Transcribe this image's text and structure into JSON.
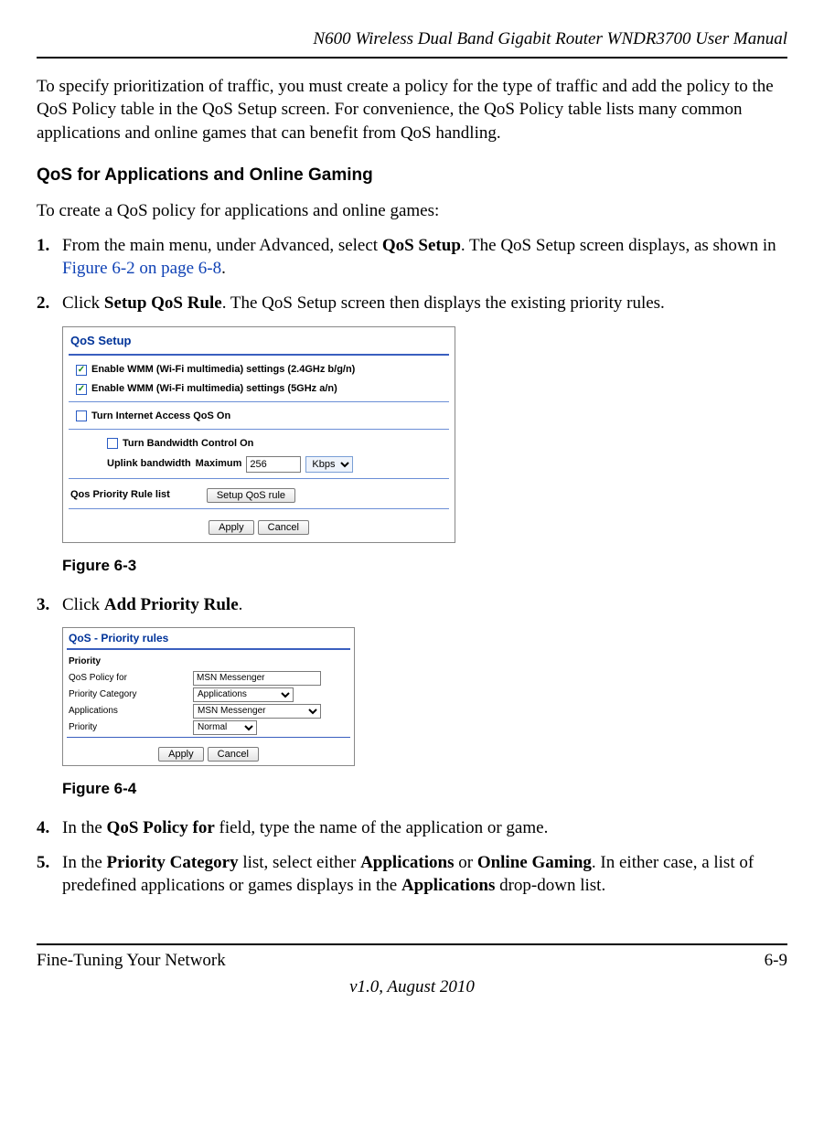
{
  "header": {
    "title": "N600 Wireless Dual Band Gigabit Router WNDR3700 User Manual"
  },
  "intro": "To specify prioritization of traffic, you must create a policy for the type of traffic and add the policy to the QoS Policy table in the QoS Setup screen. For convenience, the QoS Policy table lists many common applications and online games that can benefit from QoS handling.",
  "section_heading": "QoS for Applications and Online Gaming",
  "section_intro": "To create a QoS policy for applications and online games:",
  "steps": {
    "s1": {
      "num": "1.",
      "pre": "From the main menu, under Advanced, select ",
      "bold1": "QoS Setup",
      "mid": ". The QoS Setup screen displays, as shown in ",
      "link": "Figure 6-2 on page 6-8",
      "post": "."
    },
    "s2": {
      "num": "2.",
      "pre": "Click ",
      "bold1": "Setup QoS Rule",
      "post": ". The QoS Setup screen then displays the existing priority rules."
    },
    "s3": {
      "num": "3.",
      "pre": "Click ",
      "bold1": "Add Priority Rule",
      "post": "."
    },
    "s4": {
      "num": "4.",
      "pre": "In the ",
      "bold1": "QoS Policy for",
      "post": " field, type the name of the application or game."
    },
    "s5": {
      "num": "5.",
      "pre": "In the ",
      "bold1": "Priority Category",
      "mid1": " list, select either ",
      "bold2": "Applications",
      "mid2": " or ",
      "bold3": "Online Gaming",
      "mid3": ". In either case, a list of predefined applications or games displays in the ",
      "bold4": "Applications",
      "post": " drop-down list."
    }
  },
  "fig63": {
    "caption": "Figure 6-3",
    "panel_title": "QoS Setup",
    "wmm24": "Enable WMM (Wi-Fi multimedia) settings (2.4GHz b/g/n)",
    "wmm5": "Enable WMM (Wi-Fi multimedia) settings (5GHz a/n)",
    "internet_qos": "Turn Internet Access QoS On",
    "bandwidth_ctrl": "Turn Bandwidth Control On",
    "uplink_label": "Uplink bandwidth",
    "uplink_max": "Maximum",
    "uplink_value": "256",
    "uplink_unit": "Kbps",
    "rule_list_label": "Qos Priority Rule list",
    "setup_rule_btn": "Setup QoS rule",
    "apply_btn": "Apply",
    "cancel_btn": "Cancel"
  },
  "fig64": {
    "caption": "Figure 6-4",
    "panel_title": "QoS - Priority rules",
    "section": "Priority",
    "lbl_policy": "QoS Policy for",
    "val_policy": "MSN Messenger",
    "lbl_category": "Priority Category",
    "val_category": "Applications",
    "lbl_apps": "Applications",
    "val_apps": "MSN Messenger",
    "lbl_priority": "Priority",
    "val_priority": "Normal",
    "apply_btn": "Apply",
    "cancel_btn": "Cancel"
  },
  "footer": {
    "left": "Fine-Tuning Your Network",
    "right": "6-9",
    "version": "v1.0, August 2010"
  }
}
